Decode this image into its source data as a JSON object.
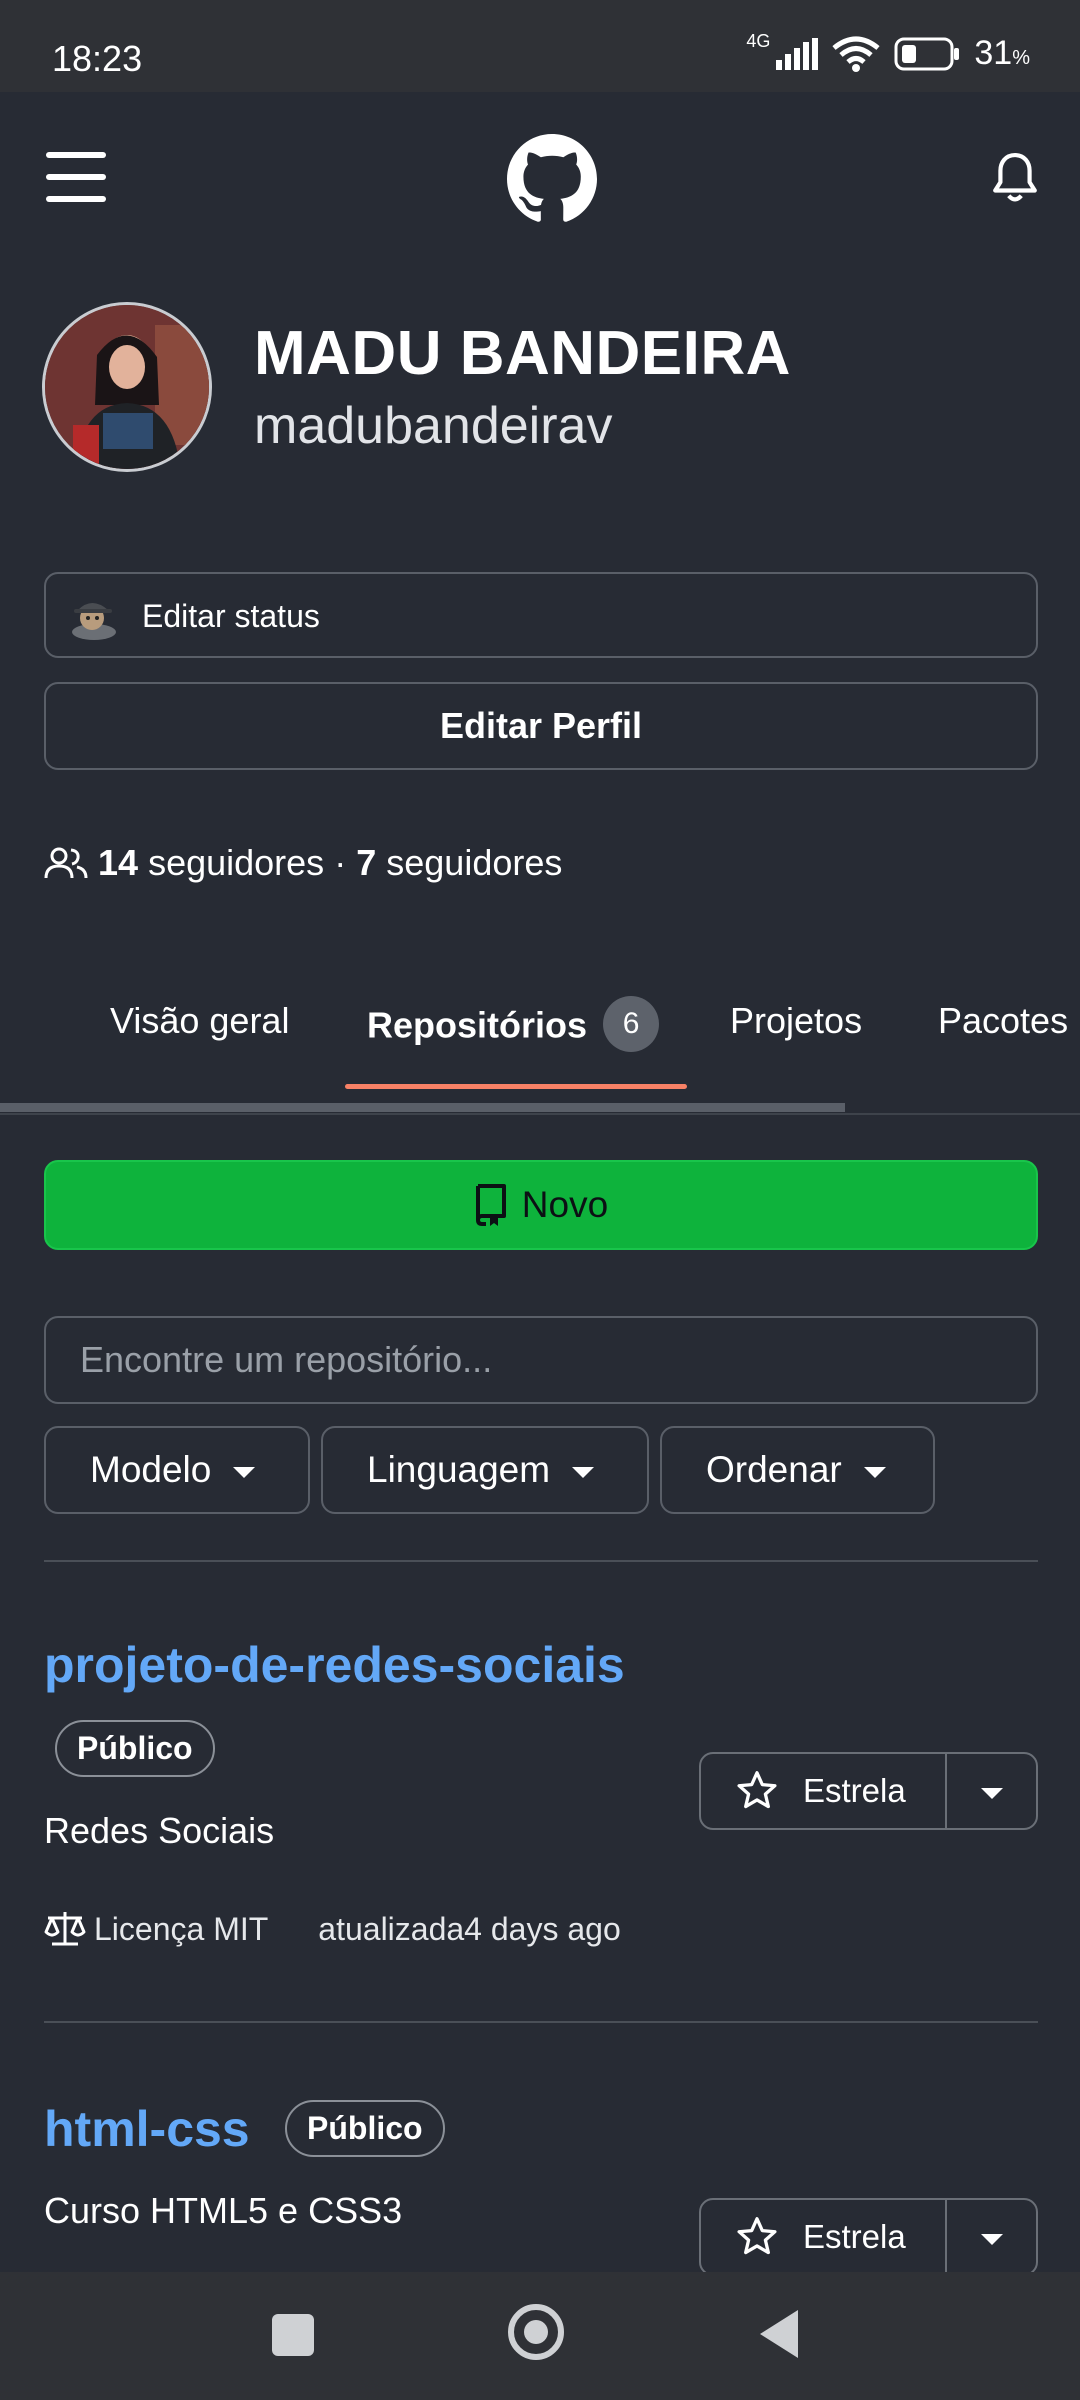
{
  "status_bar": {
    "time": "18:23",
    "network": "4G",
    "battery_value": "31",
    "battery_unit": "%"
  },
  "app_bar": {
    "menu_icon": "hamburger-menu-icon",
    "logo_icon": "github-logo-icon",
    "notifications_icon": "bell-icon"
  },
  "profile": {
    "name": "MADU BANDEIRA",
    "login": "madubandeirav",
    "edit_status_label": "Editar status",
    "edit_profile_label": "Editar Perfil",
    "followers_count": "14",
    "followers_label": "seguidores",
    "separator": "·",
    "following_count": "7",
    "following_label": "seguidores"
  },
  "tabs": [
    {
      "label": "Visão geral"
    },
    {
      "label": "Repositórios",
      "count": "6",
      "active": true
    },
    {
      "label": "Projetos"
    },
    {
      "label": "Pacotes"
    }
  ],
  "new_button": {
    "label": "Novo"
  },
  "search": {
    "placeholder": "Encontre um repositório..."
  },
  "filters": [
    {
      "label": "Modelo"
    },
    {
      "label": "Linguagem"
    },
    {
      "label": "Ordenar"
    }
  ],
  "repos": [
    {
      "name": "projeto-de-redes-sociais",
      "visibility": "Público",
      "description": "Redes Sociais",
      "license": "Licença MIT",
      "updated": "atualizada4 days ago",
      "star_label": "Estrela"
    },
    {
      "name": "html-css",
      "visibility": "Público",
      "description": "Curso HTML5 e CSS3",
      "star_label": "Estrela"
    }
  ],
  "colors": {
    "background": "#272b34",
    "link": "#63a8f7",
    "primary_button": "#0eb33c",
    "tab_underline": "#f78166"
  }
}
